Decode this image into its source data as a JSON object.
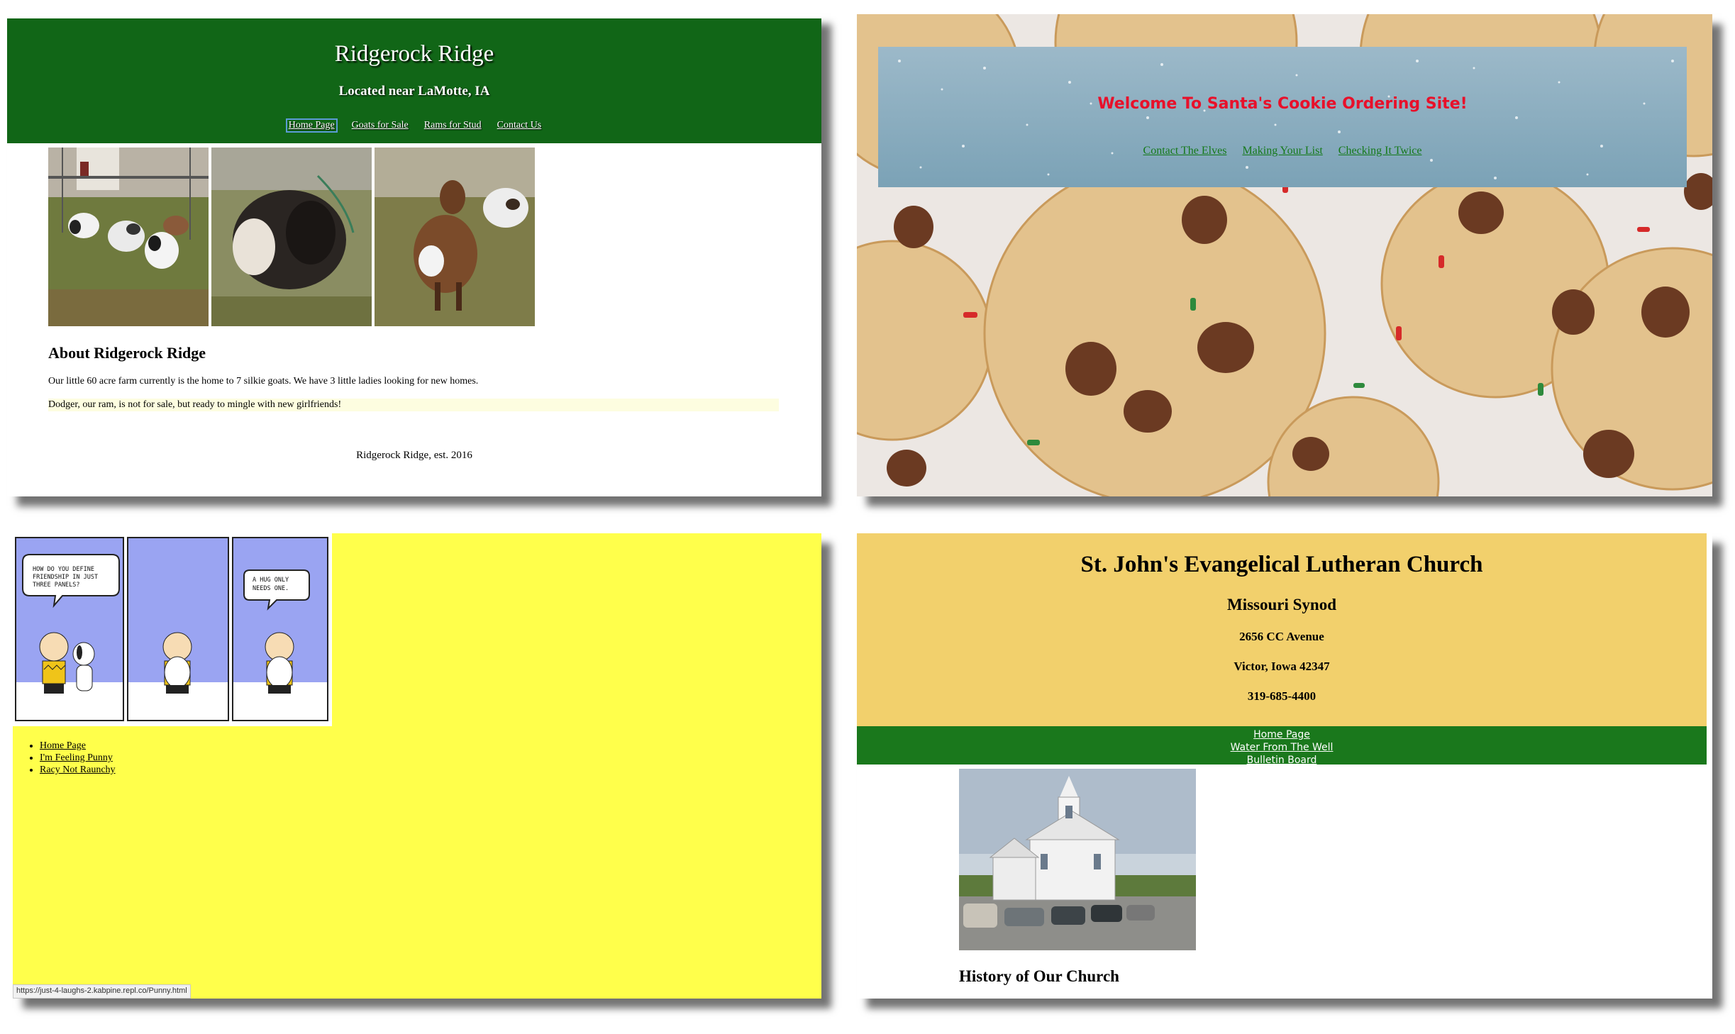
{
  "ridgerock": {
    "title": "Ridgerock Ridge",
    "subtitle": "Located near LaMotte, IA",
    "nav": [
      "Home Page",
      "Goats for Sale",
      "Rams for Stud",
      "Contact Us"
    ],
    "about_heading": "About Ridgerock Ridge",
    "about_text": "Our little 60 acre farm currently is the home to 7 silkie goats. We have 3 little ladies looking for new homes.",
    "ram_text": "Dodger, our ram, is not for sale, but ready to mingle with new girlfriends!",
    "footer": "Ridgerock Ridge, est. 2016",
    "colors": {
      "header_bg": "#116617",
      "highlight_bg": "#fdfde0"
    }
  },
  "santa": {
    "title": "Welcome To Santa's Cookie Ordering Site!",
    "nav": [
      "Contact The Elves",
      "Making Your List",
      "Checking It Twice"
    ],
    "colors": {
      "title": "#e8102a",
      "link": "#15791a"
    }
  },
  "comic": {
    "bubble1": [
      "HOW DO YOU DEFINE",
      "FRIENDSHIP IN JUST",
      "THREE PANELS?"
    ],
    "bubble2": [
      "A HUG ONLY",
      "NEEDS ONE."
    ],
    "nav": [
      "Home Page",
      "I'm Feeling Punny",
      "Racy Not Raunchy"
    ],
    "status_url": "https://just-4-laughs-2.kabpine.repl.co/Punny.html",
    "colors": {
      "page_bg": "#ffff4b",
      "panel_sky": "#9aa4f2"
    }
  },
  "church": {
    "title": "St. John's Evangelical Lutheran Church",
    "synod": "Missouri Synod",
    "address": "2656 CC Avenue",
    "city": "Victor, Iowa 42347",
    "phone": "319-685-4400",
    "nav": [
      "Home Page",
      "Water From The Well",
      "Bulletin Board"
    ],
    "history_heading": "History of Our Church",
    "colors": {
      "header_bg": "#f2d06c",
      "nav_bg": "#1a781c"
    }
  }
}
